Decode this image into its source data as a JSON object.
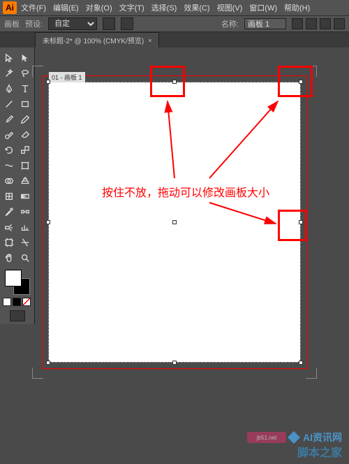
{
  "app": {
    "logo": "Ai"
  },
  "menu": {
    "file": "文件(F)",
    "edit": "编辑(E)",
    "object": "对象(O)",
    "type": "文字(T)",
    "select": "选择(S)",
    "effect": "效果(C)",
    "view": "视图(V)",
    "window": "窗口(W)",
    "help": "帮助(H)"
  },
  "optionbar": {
    "tool_label": "画板",
    "preset_label": "预设:",
    "preset_value": "自定",
    "name_label": "名称:",
    "name_value": "画板 1"
  },
  "tab": {
    "title": "未标题-2* @ 100% (CMYK/预览)",
    "close": "×"
  },
  "artboard": {
    "label": "01 - 画板 1"
  },
  "annotation": {
    "text": "按住不放，拖动可以修改画板大小"
  },
  "watermark": {
    "site1": "AI资讯网",
    "site2": "脚本之家",
    "tag": "jb51.net"
  },
  "colors": {
    "accent": "#ff7c00",
    "highlight": "#f00",
    "panel": "#535353",
    "canvas": "#4a4a4a"
  }
}
